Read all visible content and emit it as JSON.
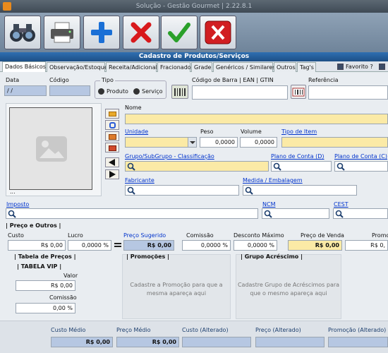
{
  "window": {
    "title": "Solução - Gestão Gourmet | 2.22.8.1"
  },
  "toolbar": {
    "buttons": [
      {
        "name": "search-button",
        "icon": "binoculars-icon"
      },
      {
        "name": "print-button",
        "icon": "printer-icon"
      },
      {
        "name": "add-button",
        "icon": "plus-icon"
      },
      {
        "name": "delete-button",
        "icon": "x-icon"
      },
      {
        "name": "confirm-button",
        "icon": "check-icon"
      },
      {
        "name": "close-button",
        "icon": "close-icon"
      }
    ]
  },
  "form": {
    "title": "Cadastro de Produtos/Serviços"
  },
  "tabs": [
    "Dados Básicos",
    "Observação/Estoque",
    "Receita/Adicional",
    "Fracionado",
    "Grade",
    "Genéricos / Similares",
    "Outros",
    "Tag's"
  ],
  "favorito": {
    "label": "Favorito ?",
    "checked": false
  },
  "labels": {
    "data": "Data",
    "codigo": "Código",
    "tipo": "Tipo",
    "produto": "Produto",
    "servico": "Serviço",
    "codigo_barra": "Código de Barra | EAN | GTIN",
    "referencia": "Referência",
    "nome": "Nome",
    "unidade": "Unidade",
    "peso": "Peso",
    "volume": "Volume",
    "tipo_item": "Tipo de Item",
    "grupo": "Grupo/SubGrupo - Classificação",
    "plano_d": "Plano de Conta (D)",
    "plano_c": "Plano de Conta (C)",
    "fabricante": "Fabricante",
    "medida": "Medida / Embalagem",
    "imposto": "Imposto",
    "ncm": "NCM",
    "cest": "CEST",
    "preco_outros": "| Preço e Outros |",
    "custo": "Custo",
    "lucro": "Lucro",
    "preco_sugerido": "Preço Sugerido",
    "comissao": "Comissão",
    "desconto_maximo": "Desconto Máximo",
    "preco_venda": "Preço de Venda",
    "promocao": "Promo",
    "tabela_precos": "| Tabela de Preços |",
    "tabela_vip": "| TABELA VIP |",
    "valor": "Valor",
    "comissao2": "Comissão",
    "promocoes": "| Promoções |",
    "grupo_acrescimo": "| Grupo Acréscimo |",
    "custo_medio": "Custo Médio",
    "preco_medio": "Preço Médio",
    "custo_alterado": "Custo (Alterado)",
    "preco_alterado": "Preço (Alterado)",
    "promocao_alterado": "Promoção (Alterado)",
    "image_caption": "..."
  },
  "values": {
    "data": "/ /",
    "peso": "0,0000",
    "volume": "0,0000",
    "custo": "R$ 0,00",
    "lucro": "0,0000 %",
    "preco_sugerido": "R$ 0,00",
    "comissao": "0,0000 %",
    "desconto_maximo": "0,0000 %",
    "preco_venda": "R$ 0,00",
    "promocao": "R$ 0,",
    "vip_valor": "R$ 0,00",
    "vip_comissao": "0,00 %",
    "custo_medio": "R$ 0,00",
    "preco_medio": "R$ 0,00"
  },
  "tipo_selected": "Produto",
  "placeholders": {
    "promocoes": "Cadastre a Promoção para que a mesma apareça aqui",
    "grupo_acrescimo": "Cadastre Grupo de Acréscimos para que o mesmo apareça aqui"
  }
}
